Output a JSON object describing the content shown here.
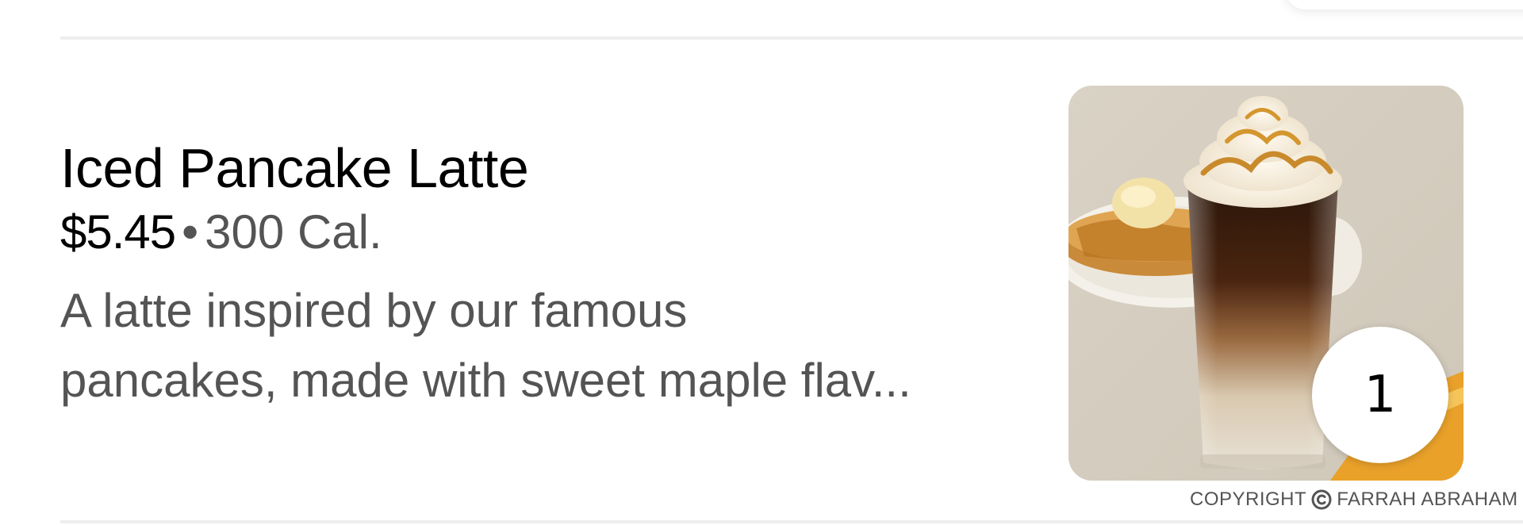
{
  "item": {
    "title": "Iced Pancake Latte",
    "price": "$5.45",
    "separator": "•",
    "calories": "300 Cal.",
    "description": "A latte inspired by our famous\npancakes, made with sweet maple flav...",
    "quantity": "1",
    "image_icon": "iced-latte-photo"
  },
  "footer": {
    "copyright_prefix": "COPYRIGHT",
    "copyright_icon": "copyright-icon",
    "copyright_name": "FARRAH ABRAHAM"
  },
  "colors": {
    "primary_text": "#000000",
    "secondary_text": "#545454",
    "divider": "#eeeeee",
    "background": "#ffffff"
  }
}
